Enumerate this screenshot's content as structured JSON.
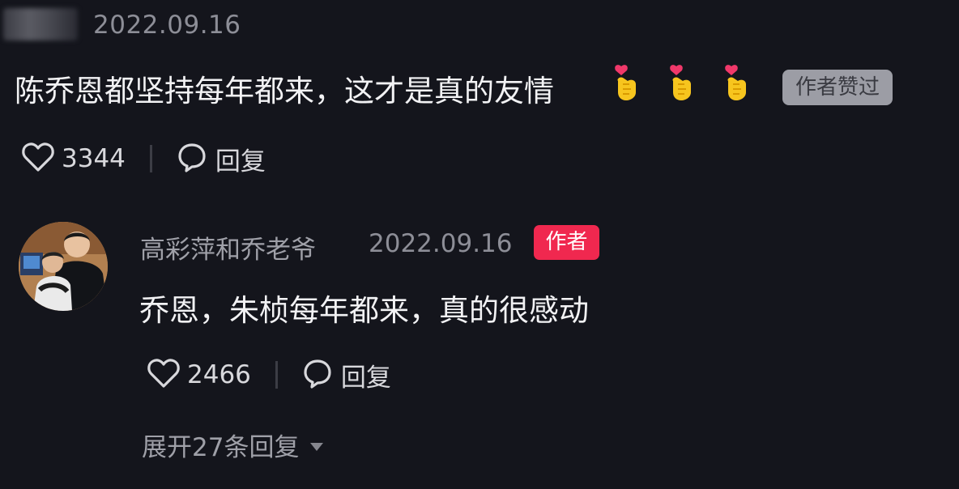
{
  "comment": {
    "date": "2022.09.16",
    "text": "陈乔恩都坚持每年都来，这才是真的友情",
    "emojis": [
      "heart-hands-emoji",
      "heart-hands-emoji",
      "heart-hands-emoji"
    ],
    "liked_badge": "作者赞过",
    "like_count": "3344",
    "reply_label": "回复"
  },
  "reply": {
    "author_name": "高彩萍和乔老爷",
    "date": "2022.09.16",
    "author_badge": "作者",
    "text": "乔恩，朱桢每年都来，真的很感动",
    "like_count": "2466",
    "reply_label": "回复",
    "expand_label": "展开27条回复"
  },
  "colors": {
    "background": "#14151c",
    "author_badge": "#f0284f",
    "liked_badge": "#9c9da5"
  }
}
